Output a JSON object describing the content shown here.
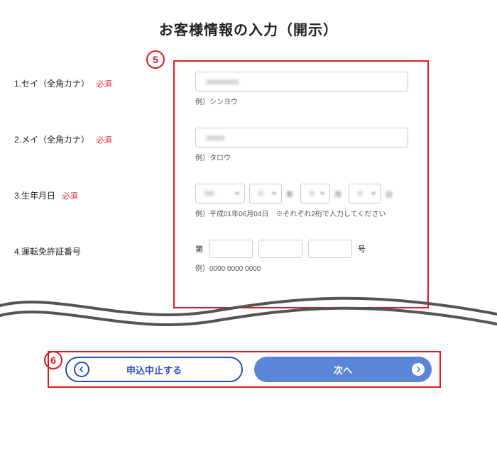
{
  "title": "お客様情報の入力（開示）",
  "annotations": {
    "five": "5",
    "six": "6"
  },
  "fields": {
    "sei": {
      "label": "1.セイ（全角カナ）",
      "required": "必須",
      "hint": "例）シンヨウ"
    },
    "mei": {
      "label": "2.メイ（全角カナ）",
      "required": "必須",
      "hint": "例）タロウ"
    },
    "dob": {
      "label": "3.生年月日",
      "required": "必須",
      "hint": "例）平成01年06月04日　※それぞれ2桁で入力してください",
      "units": {
        "year": "年",
        "month": "月",
        "day": "日"
      }
    },
    "license": {
      "label": "4.運転免許証番号",
      "prefix": "第",
      "suffix": "号",
      "hint": "例）0000 0000 0000"
    }
  },
  "buttons": {
    "cancel": "申込中止する",
    "next": "次へ"
  }
}
